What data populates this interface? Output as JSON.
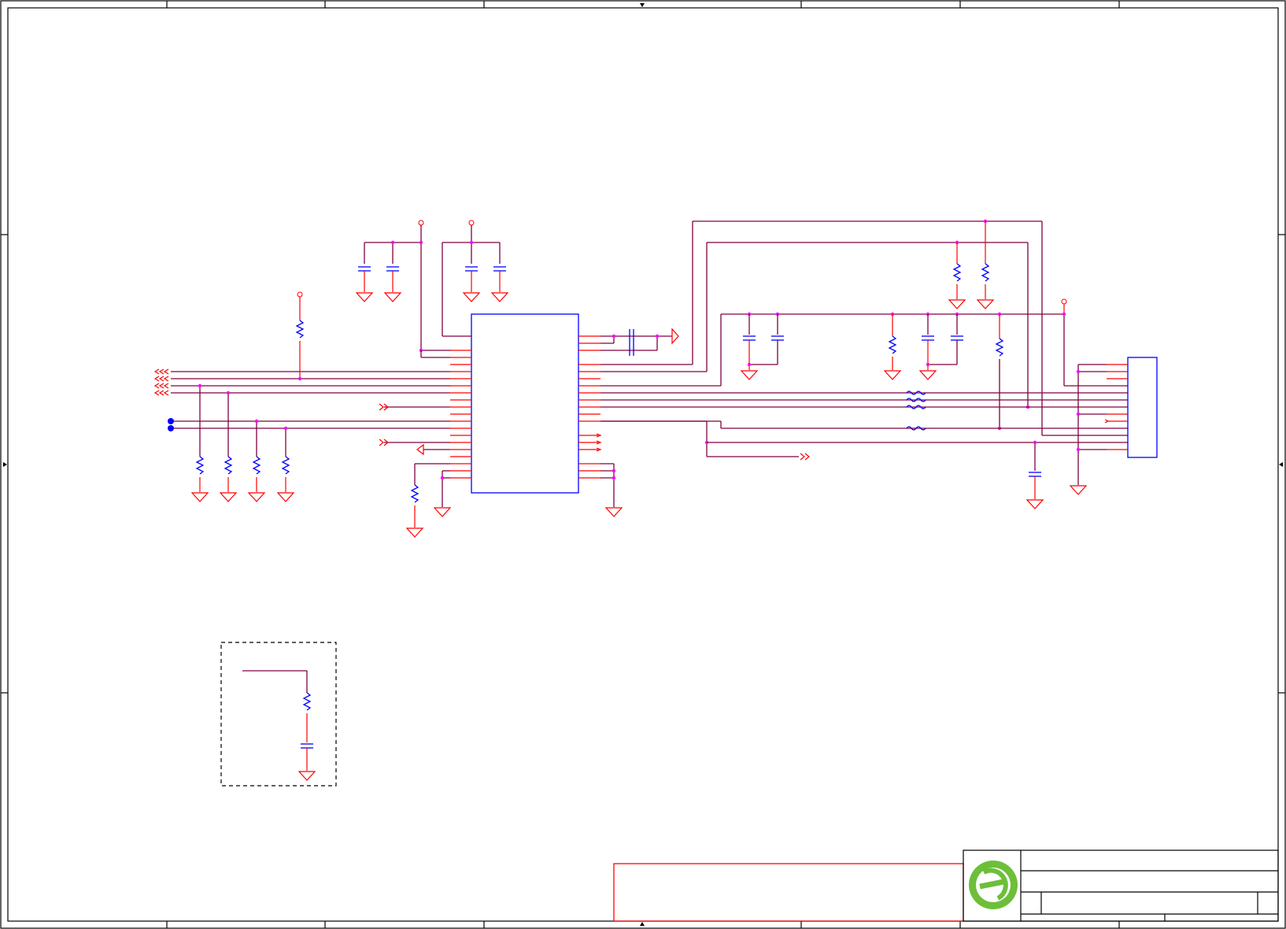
{
  "sheet": {
    "type": "schematic",
    "border_columns": 8,
    "border_rows": 4
  },
  "title_block": {
    "logo_icon": "company-logo-green-e",
    "title": "",
    "document_number": "",
    "revision": ""
  },
  "colors": {
    "wire": "#800040",
    "pin": "#ff0000",
    "component": "#0000ff",
    "junction": "#ff00ff",
    "logo": "#6dbf3a"
  },
  "components": {
    "main_ic": "ic-u1",
    "connector": "connector-j1",
    "resistor_count": 16,
    "capacitor_count": 13,
    "ground_symbol_count": 21
  }
}
